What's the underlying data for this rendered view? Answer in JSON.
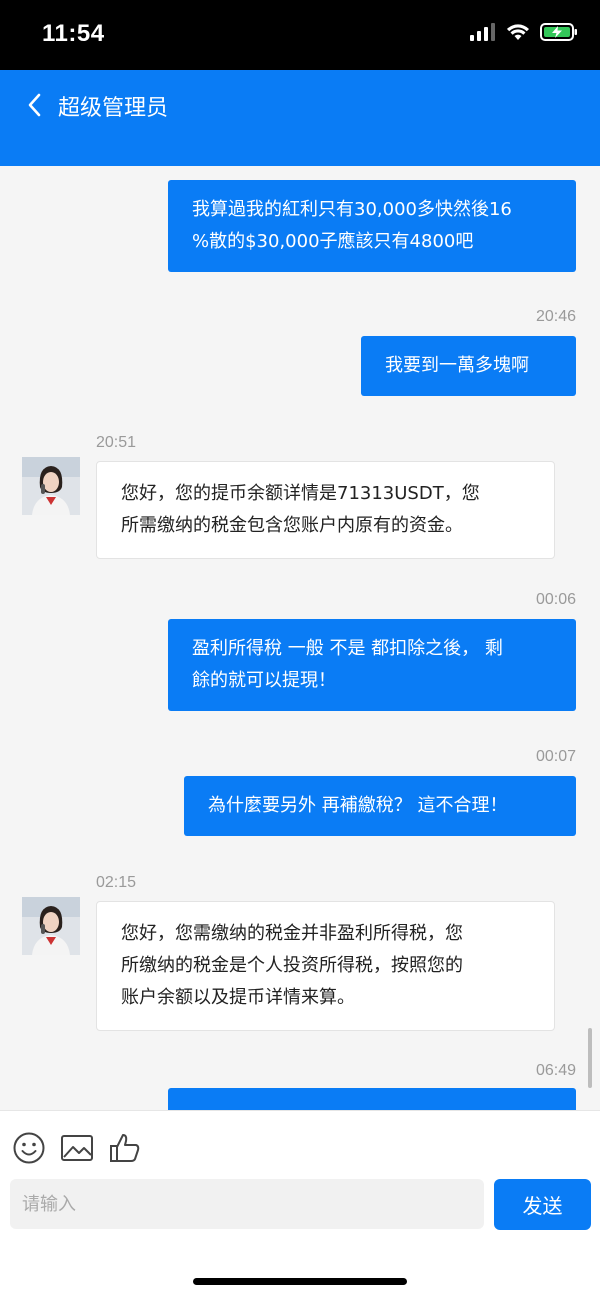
{
  "status_bar": {
    "time": "11:54",
    "icons": [
      "signal-bars-icon",
      "wifi-icon",
      "battery-charging-icon"
    ]
  },
  "header": {
    "title": "超级管理员",
    "back_icon": "chevron-left-icon",
    "background_color": "#0a7cf5"
  },
  "messages": [
    {
      "side": "right",
      "timestamp": "",
      "lines": [
        "我算過我的紅利只有30,000多快然後16",
        "%散的$30,000子應該只有4800吧"
      ]
    },
    {
      "side": "right",
      "timestamp": "20:46",
      "lines": [
        "我要到一萬多塊啊"
      ]
    },
    {
      "side": "left",
      "timestamp": "20:51",
      "lines": [
        "您好，您的提币余额详情是71313USDT，您",
        "所需缴纳的税金包含您账户内原有的资金。"
      ]
    },
    {
      "side": "right",
      "timestamp": "00:06",
      "lines": [
        "盈利所得稅 一般 不是 都扣除之後， 剩",
        "餘的就可以提現！"
      ]
    },
    {
      "side": "right",
      "timestamp": "00:07",
      "lines": [
        "為什麼要另外 再補繳稅？ 這不合理！"
      ]
    },
    {
      "side": "left",
      "timestamp": "02:15",
      "lines": [
        "您好，您需缴纳的税金并非盈利所得税，您",
        "所缴纳的税金是个人投资所得税，按照您的",
        "账户余额以及提币详情来算。"
      ]
    },
    {
      "side": "right",
      "timestamp": "06:49",
      "lines": []
    }
  ],
  "composer": {
    "tool_icons": [
      "emoji-icon",
      "image-icon",
      "thumbs-up-icon"
    ],
    "input_placeholder": "请输入",
    "input_value": "",
    "send_label": "发送"
  },
  "colors": {
    "accent": "#0a7cf5",
    "chat_background": "#f5f5f5",
    "incoming_bubble": "#ffffff"
  }
}
